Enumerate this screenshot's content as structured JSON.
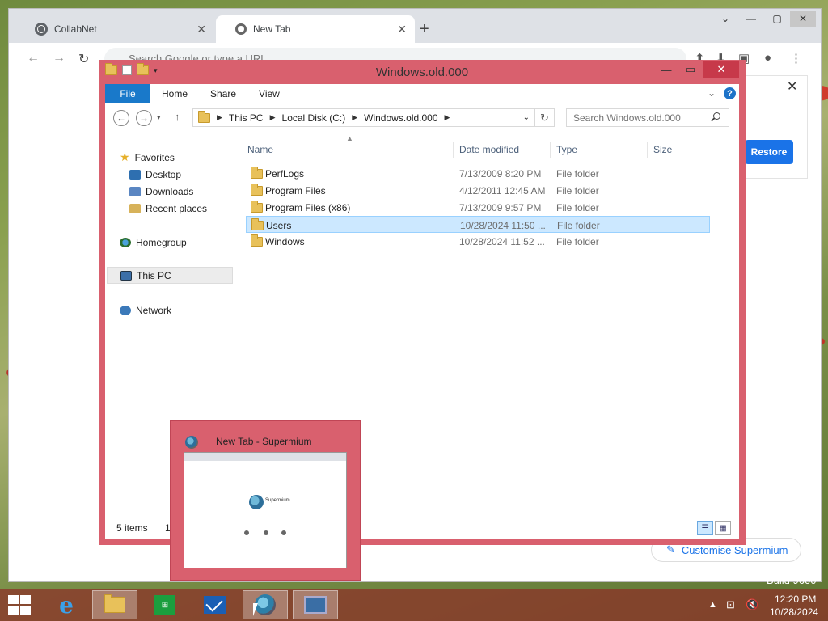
{
  "browser": {
    "tabs": [
      {
        "label": "CollabNet"
      },
      {
        "label": "New Tab"
      }
    ],
    "omnibox_placeholder": "Search Google or type a URL",
    "restore_label": "Restore",
    "customise_label": "Customise Supermium"
  },
  "explorer": {
    "title": "Windows.old.000",
    "ribbon_tabs": [
      "File",
      "Home",
      "Share",
      "View"
    ],
    "breadcrumb": [
      "This PC",
      "Local Disk (C:)",
      "Windows.old.000"
    ],
    "search_placeholder": "Search Windows.old.000",
    "columns": [
      "Name",
      "Date modified",
      "Type",
      "Size"
    ],
    "files": [
      {
        "name": "PerfLogs",
        "date": "7/13/2009 8:20 PM",
        "type": "File folder"
      },
      {
        "name": "Program Files",
        "date": "4/12/2011 12:45 AM",
        "type": "File folder"
      },
      {
        "name": "Program Files (x86)",
        "date": "7/13/2009 9:57 PM",
        "type": "File folder"
      },
      {
        "name": "Users",
        "date": "10/28/2024 11:50 ...",
        "type": "File folder"
      },
      {
        "name": "Windows",
        "date": "10/28/2024 11:52 ...",
        "type": "File folder"
      }
    ],
    "nav": {
      "favorites": "Favorites",
      "desktop": "Desktop",
      "downloads": "Downloads",
      "recent": "Recent places",
      "homegroup": "Homegroup",
      "thispc": "This PC",
      "network": "Network"
    },
    "status_items": "5 items",
    "status_selected": "1"
  },
  "thumbnail": {
    "title": "New Tab - Supermium",
    "brand": "Supermium"
  },
  "desktop": {
    "build_text": "Build 9600"
  },
  "taskbar": {
    "time": "12:20 PM",
    "date": "10/28/2024"
  }
}
